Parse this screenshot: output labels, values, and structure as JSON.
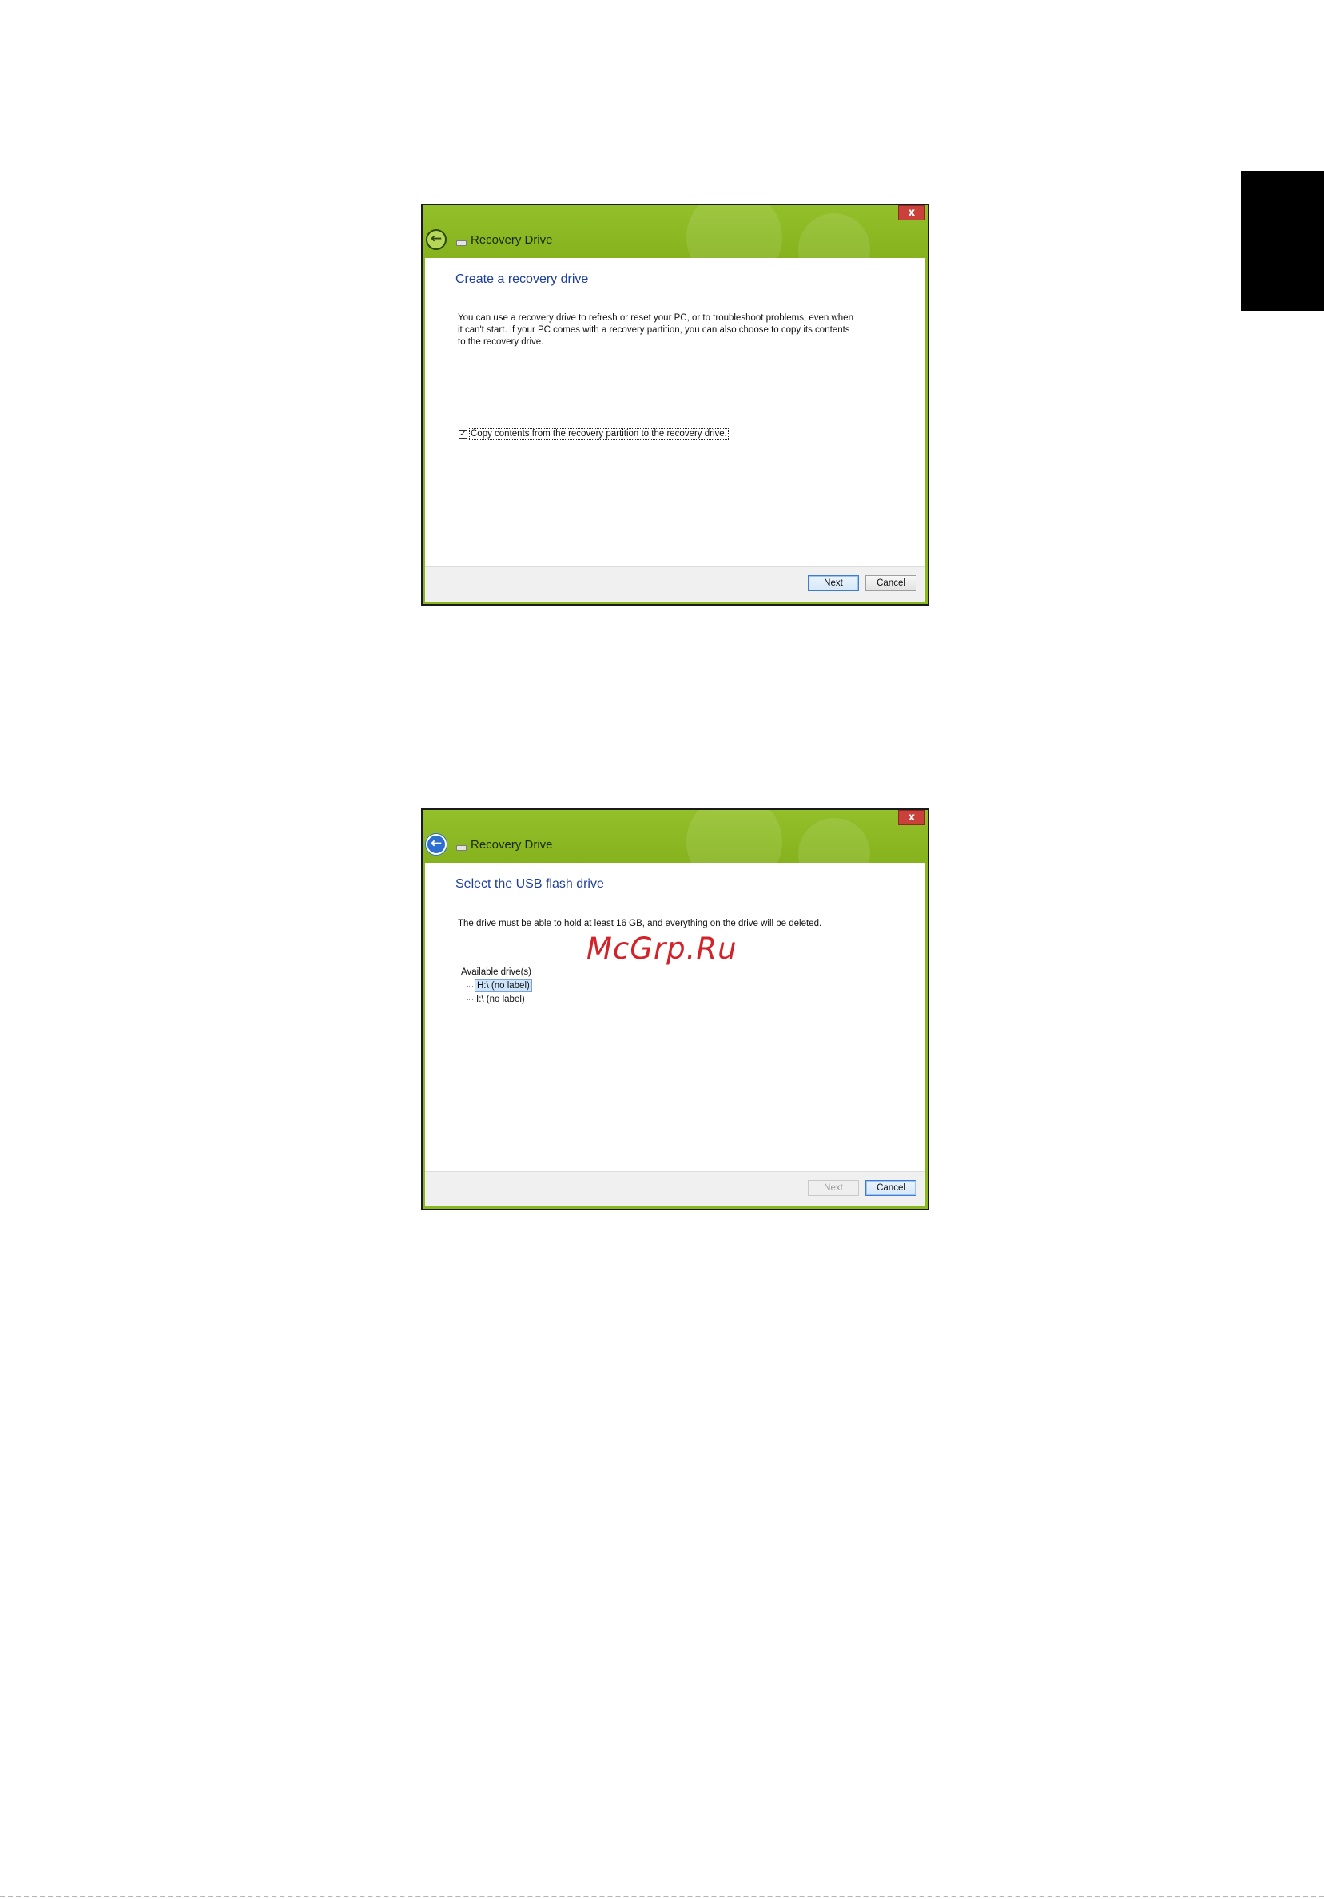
{
  "dialogs": [
    {
      "window_title": "Recovery Drive",
      "close_glyph": "x",
      "heading": "Create a recovery drive",
      "body_lines": [
        "You can use a recovery drive to refresh or reset your PC, or to troubleshoot problems, even when",
        "it can't start. If your PC comes with a recovery partition, you can also choose to copy its contents",
        "to the recovery drive."
      ],
      "checkbox": {
        "checked": true,
        "label": "Copy contents from the recovery partition to the recovery drive."
      },
      "buttons": {
        "next": "Next",
        "cancel": "Cancel"
      }
    },
    {
      "window_title": "Recovery Drive",
      "close_glyph": "x",
      "heading": "Select the USB flash drive",
      "body_lines": [
        "The drive must be able to hold at least 16 GB, and everything on the drive will be deleted."
      ],
      "drives_label": "Available drive(s)",
      "drives": [
        "H:\\ (no label)",
        "I:\\ (no label)"
      ],
      "buttons": {
        "next": "Next",
        "cancel": "Cancel"
      }
    }
  ],
  "watermark": "McGrp.Ru",
  "colors": {
    "titlebar": "#8ab61e",
    "heading": "#1e3f9e",
    "close": "#c9413a",
    "watermark": "#d2232a"
  },
  "icons": [
    "back-arrow-icon",
    "drive-icon",
    "close-icon"
  ]
}
